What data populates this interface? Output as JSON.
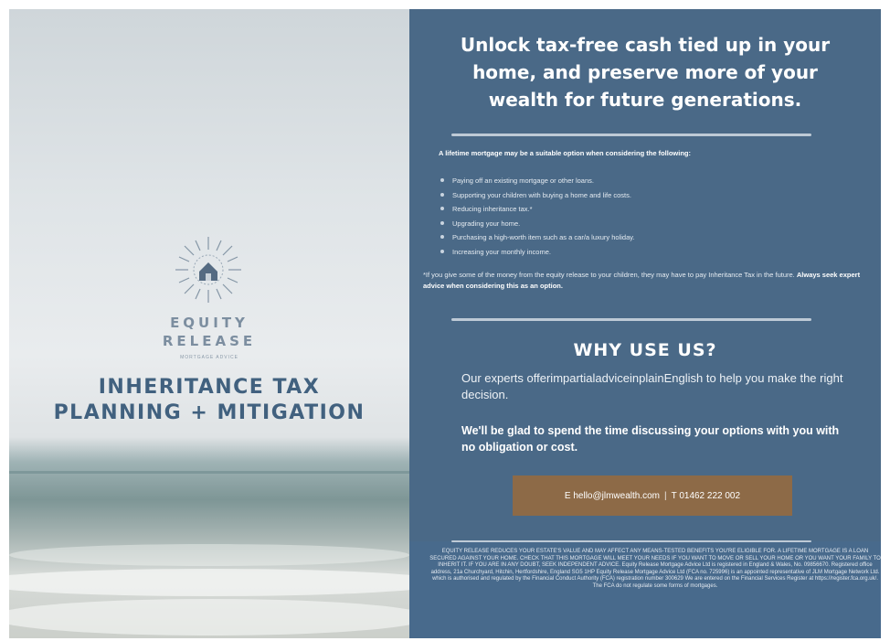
{
  "left_panel": {
    "logo_word_top": "EQUITY",
    "logo_word_bottom": "RELEASE",
    "logo_subtitle": "MORTGAGE ADVICE",
    "title_line1": "INHERITANCE TAX",
    "title_line2": "PLANNING + MITIGATION"
  },
  "right_panel": {
    "headline": "Unlock tax-free cash tied up in your home, and preserve more of your wealth for future generations.",
    "intro": "A lifetime mortgage may be a suitable option when considering the following:",
    "bullets": [
      "Paying off an existing mortgage or other loans.",
      "Supporting your children with buying a home and life costs.",
      "Reducing inheritance tax.*",
      "Upgrading your home.",
      "Purchasing a high-worth item such as a car/a luxury holiday.",
      "Increasing your monthly income."
    ],
    "note": "*If you give some of the money from the equity release to your children, they may have to pay Inheritance Tax in the future.",
    "note_bold": "Always seek expert advice when considering this as an option.",
    "why_title": "WHY USE US?",
    "why_text": "Our experts offerimpartialadviceinplainEnglish to help you make the right decision.",
    "why_bold": "We'll be glad to spend the time discussing your options with you with no obligation or cost.",
    "contact_email": "E hello@jlmwealth.com",
    "contact_separator": "|",
    "contact_phone": "T 01462 222 002",
    "disclaimer": "EQUITY RELEASE REDUCES YOUR ESTATE'S VALUE AND MAY AFFECT ANY MEANS-TESTED BENEFITS YOU'RE ELIGIBLE FOR. A LIFETIME MORTGAGE IS A LOAN SECURED AGAINST YOUR HOME. CHECK THAT THIS MORTGAGE WILL MEET YOUR NEEDS IF YOU WANT TO MOVE OR SELL YOUR HOME OR YOU WANT YOUR FAMILY TO INHERIT IT. IF YOU ARE IN ANY DOUBT, SEEK INDEPENDENT ADVICE. Equity Release Mortgage Advice Ltd is registered in England & Wales, No. 09856670. Registered office address, 21a Churchyard, Hitchin, Hertfordshire, England SG5 1HP Equity Release Mortgage Advice Ltd (FCA no. 725996) is an appointed representative of JLM Mortgage Network Ltd. which is authorised and regulated by the Financial Conduct Authority (FCA) registration number 300629 We are entered on the Financial Services Register at https://register.fca.org.uk/. The FCA do not regulate some forms of mortgages."
  },
  "colors": {
    "panel_blue": "#4a6987",
    "title_blue": "#41617f",
    "contact_brown": "#8d6a47"
  }
}
